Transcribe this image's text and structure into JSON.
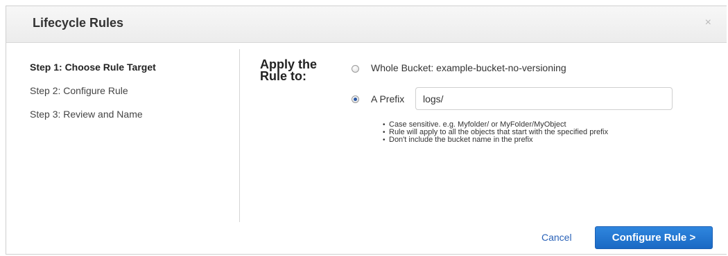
{
  "dialog": {
    "title": "Lifecycle Rules",
    "close_icon": "close-icon",
    "close_glyph": "×"
  },
  "steps": [
    {
      "label": "Step 1: Choose Rule Target",
      "active": true
    },
    {
      "label": "Step 2: Configure Rule",
      "active": false
    },
    {
      "label": "Step 3: Review and Name",
      "active": false
    }
  ],
  "apply": {
    "heading": "Apply the Rule to:",
    "options": {
      "whole_bucket": {
        "label": "Whole Bucket: example-bucket-no-versioning",
        "checked": false
      },
      "prefix": {
        "label": "A Prefix",
        "checked": true,
        "value": "logs/"
      }
    },
    "hints": [
      "Case sensitive. e.g. Myfolder/ or MyFolder/MyObject",
      "Rule will apply to all the objects that start with the specified prefix",
      "Don't include the bucket name in the prefix"
    ]
  },
  "footer": {
    "cancel_label": "Cancel",
    "primary_label": "Configure Rule >"
  },
  "colors": {
    "primary": "#1a69c4",
    "link": "#2a62b8",
    "radio_selected": "#2b59a6"
  }
}
